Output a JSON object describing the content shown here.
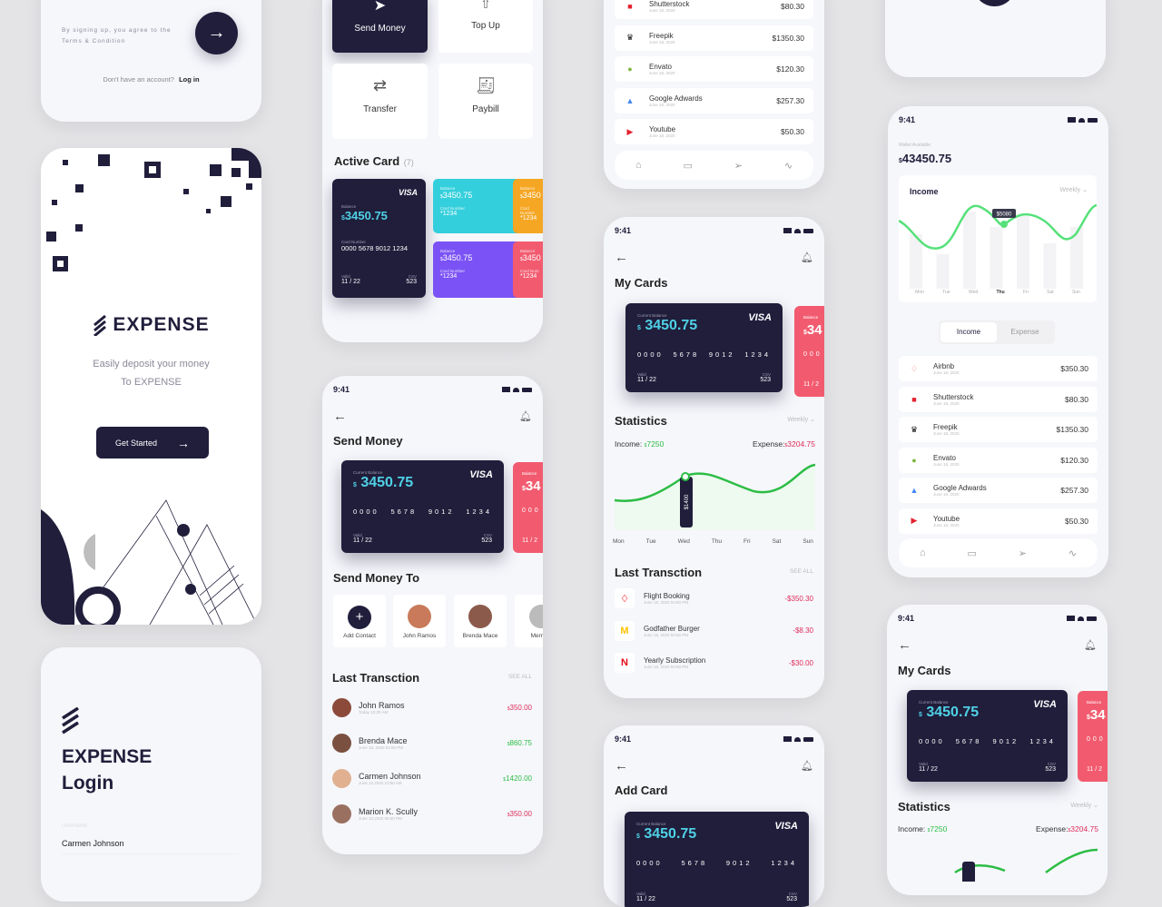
{
  "signup_bottom": {
    "terms": "By signing up, you agree to the Terms & Condition",
    "no_account": "Don't have an account?",
    "login_link": "Log in"
  },
  "splash": {
    "brand": "EXPENSE",
    "tagline1": "Easily deposit your money",
    "tagline2": "To EXPENSE",
    "cta": "Get Started"
  },
  "login": {
    "brand": "EXPENSE",
    "heading": "Login",
    "username_label": "Username",
    "username_value": "Carmen Johnson"
  },
  "home": {
    "actions": [
      {
        "label": "Send Money",
        "icon": "send-icon"
      },
      {
        "label": "Top Up",
        "icon": "topup-icon"
      },
      {
        "label": "Transfer",
        "icon": "transfer-icon"
      },
      {
        "label": "Paybill",
        "icon": "paybill-icon"
      }
    ],
    "active_card_title": "Active Card",
    "active_card_count": "(7)",
    "main_card": {
      "brand": "VISA",
      "balance_label": "Balance",
      "currency": "$",
      "balance": "3450.75",
      "number_label": "Card Number",
      "number": "0000 5678 9012 1234",
      "valid_label": "Valid",
      "valid": "11 / 22",
      "csv_label": "CSV",
      "csv": "523"
    },
    "mini_cards": [
      {
        "color": "#34cfdc",
        "balance_label": "Balance",
        "currency": "$",
        "balance": "3450.75",
        "number_label": "Card Number",
        "number": "*1234"
      },
      {
        "color": "#f5a623",
        "balance_label": "Balance",
        "currency": "$",
        "balance": "3450",
        "number_label": "Card Number",
        "number": "*1234"
      },
      {
        "color": "#7b52f5",
        "balance_label": "Balance",
        "currency": "$",
        "balance": "3450.75",
        "number_label": "Card Number",
        "number": "*1234"
      },
      {
        "color": "#f25b6f",
        "balance_label": "Balance",
        "currency": "$",
        "balance": "3450",
        "number_label": "Card Num",
        "number": "*1234"
      }
    ]
  },
  "expense_list": {
    "items": [
      {
        "name": "Shutterstock",
        "date": "June 18, 2020",
        "amount": "$80.30",
        "icon": "shutterstock-icon"
      },
      {
        "name": "Freepik",
        "date": "June 18, 2020",
        "amount": "$1350.30",
        "icon": "freepik-icon"
      },
      {
        "name": "Envato",
        "date": "June 18, 2020",
        "amount": "$120.30",
        "icon": "envato-icon"
      },
      {
        "name": "Google Adwards",
        "date": "June 18, 2020",
        "amount": "$257.30",
        "icon": "google-ads-icon"
      },
      {
        "name": "Youtube",
        "date": "June 18, 2020",
        "amount": "$50.30",
        "icon": "youtube-icon"
      }
    ]
  },
  "status": {
    "time": "9:41"
  },
  "wallet": {
    "label": "Wallet Available",
    "currency": "$",
    "amount": "43450.75",
    "chart_title": "Income",
    "period": "Weekly",
    "tooltip": "$5080",
    "days": [
      "Mon",
      "Tue",
      "Wed",
      "Thu",
      "Fri",
      "Sat",
      "Sun"
    ],
    "active_day": "Thu",
    "tabs": [
      "Income",
      "Expense"
    ],
    "items": [
      {
        "name": "Airbnb",
        "date": "June 18, 2020",
        "amount": "$350.30"
      },
      {
        "name": "Shutterstock",
        "date": "June 18, 2020",
        "amount": "$80.30"
      },
      {
        "name": "Freepik",
        "date": "June 18, 2020",
        "amount": "$1350.30"
      },
      {
        "name": "Envato",
        "date": "June 18, 2020",
        "amount": "$120.30"
      },
      {
        "name": "Google Adwards",
        "date": "June 18, 2020",
        "amount": "$257.30"
      },
      {
        "name": "Youtube",
        "date": "June 18, 2020",
        "amount": "$50.30"
      }
    ]
  },
  "card_common": {
    "balance_label": "Current Balance",
    "currency": "$",
    "balance": "3450.75",
    "brand": "VISA",
    "number": [
      "0000",
      "5678",
      "9012",
      "1234"
    ],
    "valid_label": "Valid",
    "valid": "11 / 22",
    "csv_label": "CSV",
    "csv": "523",
    "peek_label": "Balance",
    "peek_balance": "34",
    "peek_valid": "11 / 2"
  },
  "my_cards": {
    "title": "My Cards",
    "stats_title": "Statistics",
    "period": "Weekly",
    "income_label": "Income:",
    "income_cur": "$",
    "income": "7250",
    "expense_label": "Expense:",
    "expense_cur": "$",
    "expense": "3204.75",
    "tooltip": "$1400",
    "days": [
      "Mon",
      "Tue",
      "Wed",
      "Thu",
      "Fri",
      "Sat",
      "Sun"
    ],
    "last_title": "Last Transction",
    "see_all": "SEE ALL",
    "transactions": [
      {
        "name": "Flight Booking",
        "date": "June 18, 2020 04:50 PM",
        "amount": "-$350.30",
        "icon": "airbnb-icon"
      },
      {
        "name": "Godfather Burger",
        "date": "June 18, 2020 04:50 PM",
        "amount": "-$8.30",
        "icon": "mcdonalds-icon"
      },
      {
        "name": "Yearly Subscription",
        "date": "June 18, 2020 04:50 PM",
        "amount": "-$30.00",
        "icon": "netflix-icon"
      }
    ]
  },
  "send_money": {
    "title": "Send Money",
    "to_title": "Send Money To",
    "contacts": [
      "Add Contact",
      "John Ramos",
      "Brenda Mace",
      "Merry B"
    ],
    "last_title": "Last Transction",
    "see_all": "SEE ALL",
    "transactions": [
      {
        "name": "John Ramos",
        "date": "Today  10:30 AM",
        "cur": "$",
        "amount": "350.00",
        "type": "out"
      },
      {
        "name": "Brenda Mace",
        "date": "June 18, 2020 04:50 PM",
        "cur": "$",
        "amount": "860.75",
        "type": "in"
      },
      {
        "name": "Carmen Johnson",
        "date": "June 12,2020  10:50 AM",
        "cur": "$",
        "amount": "1420.00",
        "type": "in"
      },
      {
        "name": "Marion K. Scully",
        "date": "June 10,2020  09:50 PM",
        "cur": "$",
        "amount": "350.00",
        "type": "out"
      }
    ]
  },
  "add_card": {
    "title": "Add Card"
  }
}
